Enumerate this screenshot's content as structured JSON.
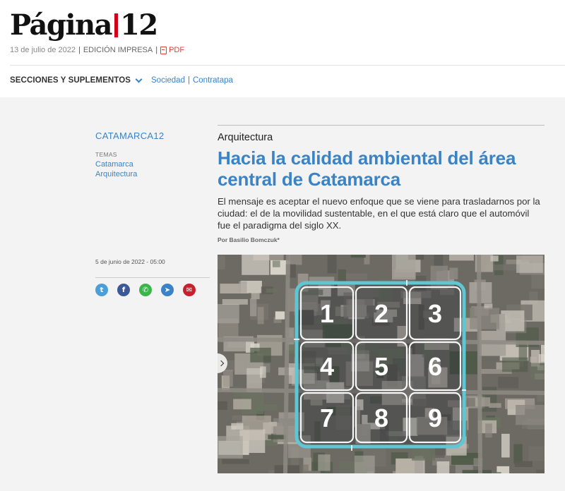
{
  "header": {
    "logo_left": "Página",
    "logo_right": "12",
    "date": "13 de julio de 2022",
    "sep1": "|",
    "edition": "EDICIÓN IMPRESA",
    "sep2": "|",
    "pdf": "PDF"
  },
  "nav": {
    "sections_label": "SECCIONES Y SUPLEMENTOS",
    "links": [
      "Sociedad",
      "Contratapa"
    ],
    "pipe": "|"
  },
  "sidebar": {
    "kicker": "CATAMARCA12",
    "temas_label": "TEMAS",
    "temas": [
      "Catamarca",
      "Arquitectura"
    ],
    "pubdate": "5 de junio de 2022 - 05:00",
    "share": [
      {
        "icon": "twitter-icon",
        "glyph": "t",
        "color": "#4a9fd8"
      },
      {
        "icon": "facebook-icon",
        "glyph": "f",
        "color": "#3b5998"
      },
      {
        "icon": "whatsapp-icon",
        "glyph": "✆",
        "color": "#39b54a"
      },
      {
        "icon": "telegram-icon",
        "glyph": "➤",
        "color": "#3a83c6"
      },
      {
        "icon": "email-icon",
        "glyph": "✉",
        "color": "#c8202c"
      }
    ]
  },
  "article": {
    "section": "Arquitectura",
    "headline": "Hacia la calidad ambiental del área central de Catamarca",
    "dek": "El mensaje es aceptar el nuevo enfoque que se viene para trasladarnos por la ciudad: el de la movilidad sustentable, en el que está claro que el automóvil fue el paradigma del siglo XX.",
    "byline": "Por Basilio Bomczuk*",
    "image_numbers": [
      "1",
      "2",
      "3",
      "4",
      "5",
      "6",
      "7",
      "8",
      "9"
    ]
  },
  "colors": {
    "accent": "#3a83c6",
    "logo_bar": "#d0021b",
    "pdf": "#e0403a",
    "grid_outline": "#5fc6d4"
  }
}
